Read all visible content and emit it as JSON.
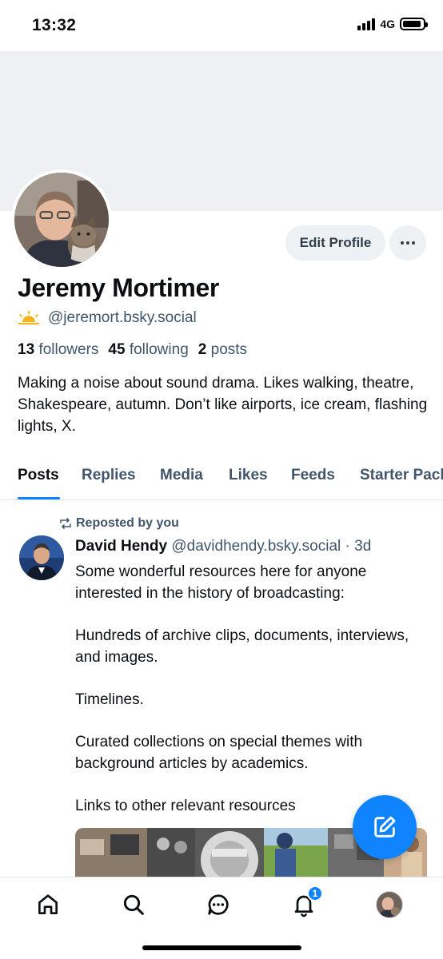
{
  "status_bar": {
    "time": "13:32",
    "network": "4G",
    "battery_level": 0.9
  },
  "profile": {
    "display_name": "Jeremy Mortimer",
    "handle": "@jeremort.bsky.social",
    "followers_count": "13",
    "followers_label": "followers",
    "following_count": "45",
    "following_label": "following",
    "posts_count": "2",
    "posts_label": "posts",
    "bio": "Making a noise about sound drama. Likes walking, theatre, Shakespeare, autumn. Don’t like airports, ice cream, flashing lights, X.",
    "edit_button_label": "Edit Profile"
  },
  "tabs": [
    {
      "label": "Posts",
      "active": true
    },
    {
      "label": "Replies",
      "active": false
    },
    {
      "label": "Media",
      "active": false
    },
    {
      "label": "Likes",
      "active": false
    },
    {
      "label": "Feeds",
      "active": false
    },
    {
      "label": "Starter Packs",
      "active": false
    }
  ],
  "post": {
    "repost_label": "Reposted by you",
    "author": "David Hendy",
    "handle": "@davidhendy.bsky.social",
    "separator": "·",
    "age": "3d",
    "paragraphs": [
      "Some wonderful resources here for anyone interested in the history of broadcasting:",
      "Hundreds of archive clips, documents, interviews, and images.",
      "Timelines.",
      "Curated collections on special themes with background articles by academics.",
      "Links to other relevant resources"
    ]
  },
  "bottom_nav": {
    "items": [
      "home-icon",
      "search-icon",
      "chat-icon",
      "bell-icon",
      "profile-avatar"
    ],
    "notification_badge": "1"
  },
  "colors": {
    "accent": "#1083fe",
    "muted_text": "#42566b",
    "banner": "#eef0f3",
    "button_bg": "#eef1f4"
  }
}
